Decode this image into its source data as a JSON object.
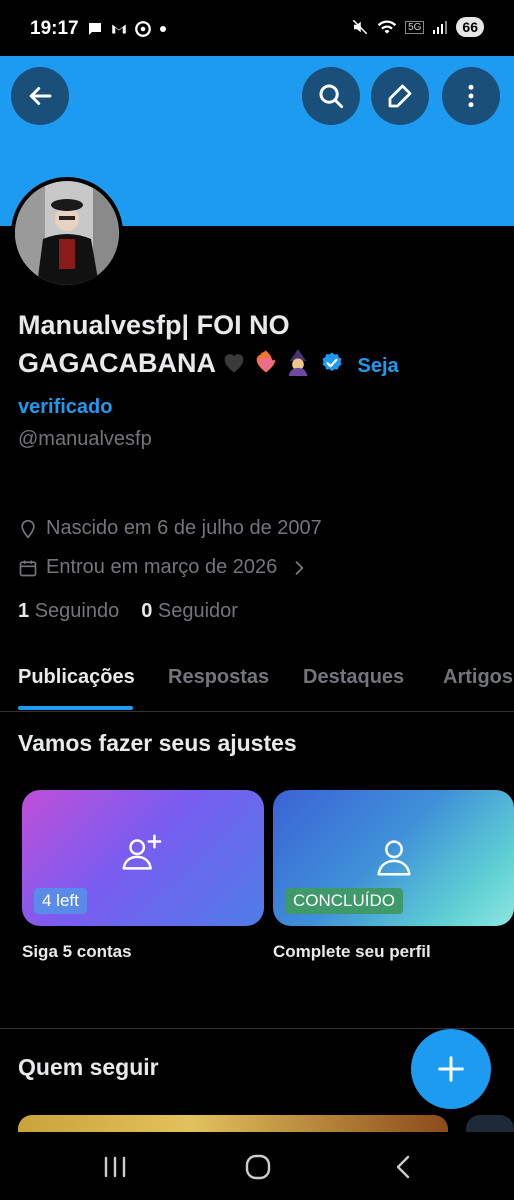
{
  "status_bar": {
    "time": "19:17",
    "network_label": "5G",
    "battery": "66"
  },
  "profile": {
    "name": "Manualvesfp| FOI NO GAGACABANA",
    "verify_link_part1": "Seja",
    "verify_link_part2": "verificado",
    "handle": "@manualvesfp",
    "birth": "Nascido em 6 de julho de 2007",
    "joined": "Entrou em março de 2026",
    "following_count": "1",
    "following_label": "Seguindo",
    "followers_count": "0",
    "followers_label": "Seguidor"
  },
  "tabs": [
    {
      "label": "Publicações",
      "active": true
    },
    {
      "label": "Respostas",
      "active": false
    },
    {
      "label": "Destaques",
      "active": false
    },
    {
      "label": "Artigos",
      "active": false
    }
  ],
  "setup": {
    "title": "Vamos fazer seus ajustes",
    "cards": [
      {
        "pill": "4 left",
        "caption": "Siga 5 contas"
      },
      {
        "pill": "CONCLUÍDO",
        "caption": "Complete seu perfil"
      }
    ]
  },
  "who_to_follow": {
    "title": "Quem seguir"
  },
  "colors": {
    "accent": "#1d9bf0",
    "banner": "#1d9bf0",
    "background": "#000000",
    "muted": "#71767b"
  },
  "icons": [
    "back-arrow-icon",
    "search-icon",
    "edit-icon",
    "more-vert-icon",
    "verified-icon",
    "location-icon",
    "calendar-icon",
    "chevron-right-icon",
    "add-user-icon",
    "user-icon",
    "plus-icon",
    "recent-apps-icon",
    "home-icon",
    "back-icon"
  ]
}
